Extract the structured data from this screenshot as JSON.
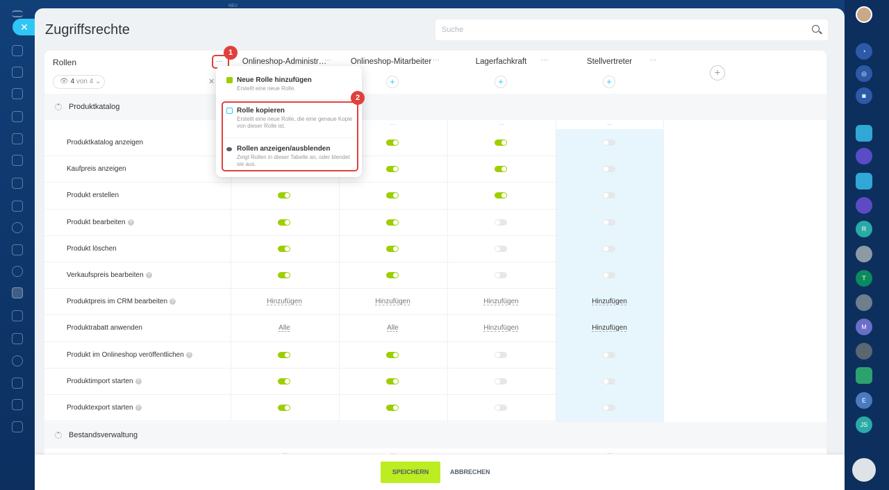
{
  "top": {
    "neu": "NEU"
  },
  "page": {
    "title": "Zugriffsrechte",
    "search_placeholder": "Suche"
  },
  "roles_header": {
    "label": "Rollen",
    "count_value": "4",
    "count_text": "von 4"
  },
  "columns": [
    {
      "name": "Onlineshop-Administr…",
      "dots": "···"
    },
    {
      "name": "Onlineshop-Mitarbeiter",
      "dots": "···"
    },
    {
      "name": "Lagerfachkraft",
      "dots": "···"
    },
    {
      "name": "Stellvertreter",
      "dots": "···"
    }
  ],
  "sections": {
    "s1": "Produktkatalog",
    "s2": "Bestandsverwaltung"
  },
  "rows": [
    {
      "label": "Produktkatalog anzeigen",
      "help": false,
      "cells": [
        "on",
        "on",
        "on",
        "off"
      ]
    },
    {
      "label": "Kaufpreis anzeigen",
      "help": false,
      "cells": [
        "on",
        "on",
        "on",
        "off"
      ]
    },
    {
      "label": "Produkt erstellen",
      "help": false,
      "cells": [
        "on",
        "on",
        "on",
        "off"
      ]
    },
    {
      "label": "Produkt bearbeiten",
      "help": true,
      "cells": [
        "on",
        "on",
        "off",
        "off"
      ]
    },
    {
      "label": "Produkt löschen",
      "help": false,
      "cells": [
        "on",
        "on",
        "off",
        "off"
      ]
    },
    {
      "label": "Verkaufspreis bearbeiten",
      "help": true,
      "cells": [
        "on",
        "on",
        "off",
        "off"
      ]
    },
    {
      "label": "Produktpreis im CRM bearbeiten",
      "help": true,
      "cells": [
        "Hinzufügen",
        "Hinzufügen",
        "Hinzufügen",
        "Hinzufügen"
      ]
    },
    {
      "label": "Produktrabatt anwenden",
      "help": false,
      "cells": [
        "Alle",
        "Alle",
        "Hinzufügen",
        "Hinzufügen"
      ]
    },
    {
      "label": "Produkt im Onlineshop veröffentlichen",
      "help": true,
      "cells": [
        "on",
        "on",
        "off",
        "off"
      ]
    },
    {
      "label": "Produktimport starten",
      "help": true,
      "cells": [
        "on",
        "on",
        "off",
        "off"
      ]
    },
    {
      "label": "Produktexport starten",
      "help": true,
      "cells": [
        "on",
        "on",
        "off",
        "off"
      ]
    }
  ],
  "menu": {
    "items": [
      {
        "title": "Neue Rolle hinzufügen",
        "desc": "Erstellt eine neue Rolle."
      },
      {
        "title": "Rolle kopieren",
        "desc": "Erstellt eine neue Rolle, die eine genaue Kopie von dieser Rolle ist."
      },
      {
        "title": "Rollen anzeigen/ausblenden",
        "desc": "Zeigt Rollen in dieser Tabelle an, oder blendet sie aus."
      }
    ]
  },
  "badges": [
    "1",
    "2"
  ],
  "footer": {
    "save": "SPEICHERN",
    "cancel": "ABBRECHEN"
  },
  "rightbar": [
    "R",
    "T",
    "M",
    "E",
    "JS"
  ],
  "colors": {
    "toggle_on": "#9dcf00",
    "save": "#bbed21",
    "accent": "#2fc6f6",
    "highlight": "#e0403c"
  }
}
